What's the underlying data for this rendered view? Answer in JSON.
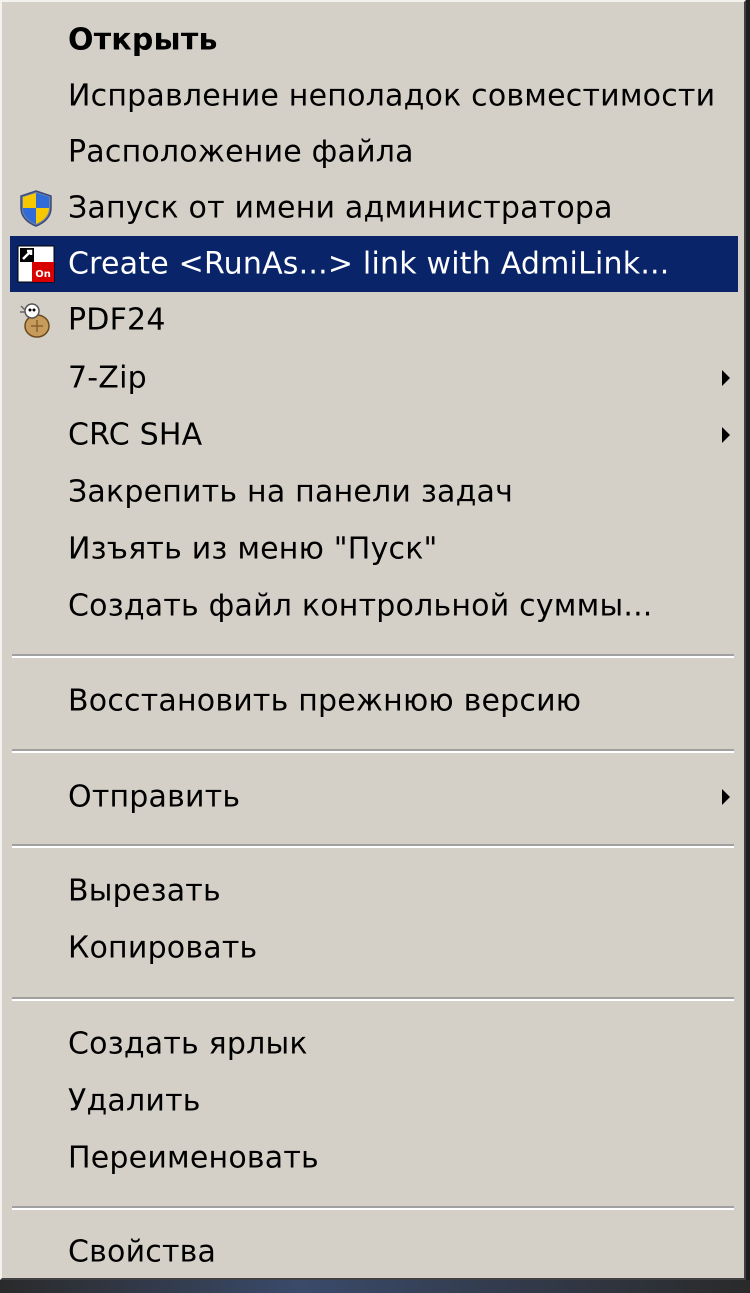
{
  "menu": {
    "items": [
      {
        "label": "Открыть",
        "bold": true
      },
      {
        "label": "Исправление неполадок совместимости"
      },
      {
        "label": "Расположение файла"
      },
      {
        "label": "Запуск от имени администратора",
        "icon": "uac-shield-icon"
      },
      {
        "label": "Create <RunAs...> link with AdmiLink...",
        "icon": "admilink-icon",
        "selected": true
      },
      {
        "label": "PDF24",
        "icon": "pdf24-icon"
      },
      {
        "label": "7-Zip",
        "submenu": true
      },
      {
        "label": "CRC SHA",
        "submenu": true
      },
      {
        "label": "Закрепить на панели задач"
      },
      {
        "label": "Изъять из меню \"Пуск\""
      },
      {
        "label": "Создать файл контрольной суммы..."
      },
      {
        "label": "Восстановить прежнюю версию"
      },
      {
        "label": "Отправить",
        "submenu": true
      },
      {
        "label": "Вырезать"
      },
      {
        "label": "Копировать"
      },
      {
        "label": "Создать ярлык"
      },
      {
        "label": "Удалить"
      },
      {
        "label": "Переименовать"
      },
      {
        "label": "Свойства"
      }
    ]
  },
  "colors": {
    "menu_background": "#d4d0c8",
    "selection_background": "#0a246a",
    "selection_text": "#ffffff"
  }
}
